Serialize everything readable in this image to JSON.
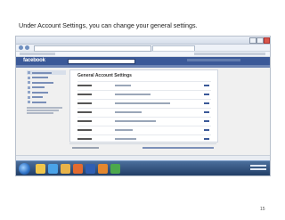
{
  "caption": "Under Account Settings, you can change your general settings.",
  "page_number": "15",
  "facebook": {
    "logo": "facebook",
    "page_title": "General Account Settings"
  },
  "sidebar": {
    "items": [
      {
        "icon": "gear-icon",
        "active": true
      },
      {
        "icon": "shield-icon"
      },
      {
        "icon": "bell-icon"
      },
      {
        "icon": "phone-icon"
      },
      {
        "icon": "credit-card-icon"
      },
      {
        "icon": "apps-icon"
      },
      {
        "icon": "ads-icon"
      }
    ]
  },
  "settings_rows": 7,
  "taskbar": {
    "apps": [
      "explorer-icon",
      "ie-icon",
      "folder-icon",
      "media-icon",
      "word-icon",
      "firefox-icon",
      "chrome-icon"
    ]
  }
}
